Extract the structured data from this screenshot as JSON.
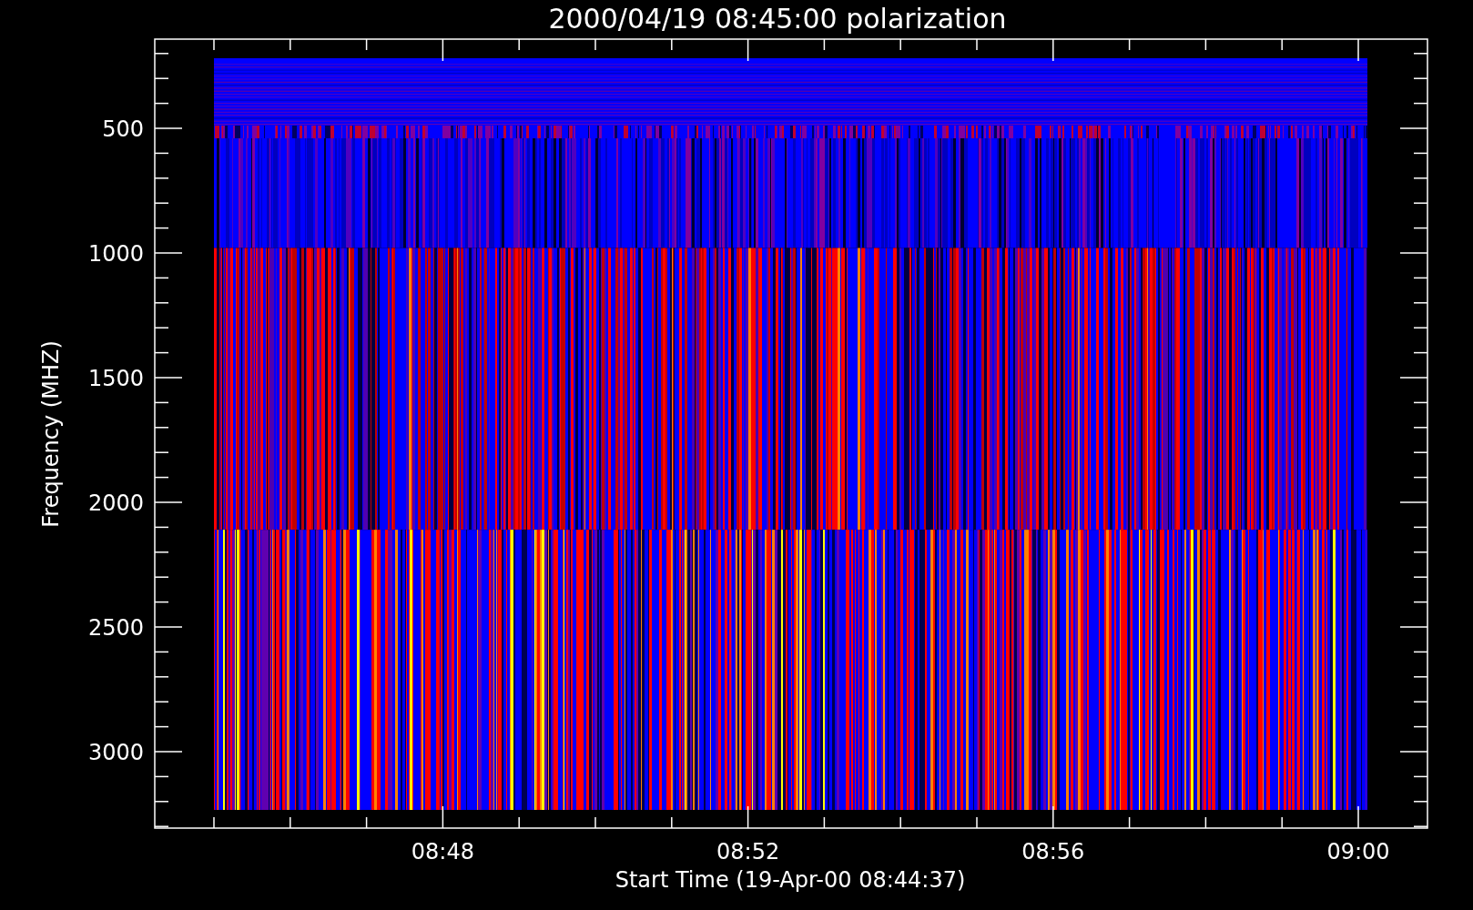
{
  "plot": {
    "title": "2000/04/19 08:45:00 polarization",
    "ylabel": "Frequency (MHZ)",
    "xlabel": "Start Time (19-Apr-00 08:44:37)",
    "yticks": [
      "500",
      "1000",
      "1500",
      "2000",
      "2500",
      "3000"
    ],
    "xticks": [
      "08:48",
      "08:52",
      "08:56",
      "09:00"
    ]
  }
}
